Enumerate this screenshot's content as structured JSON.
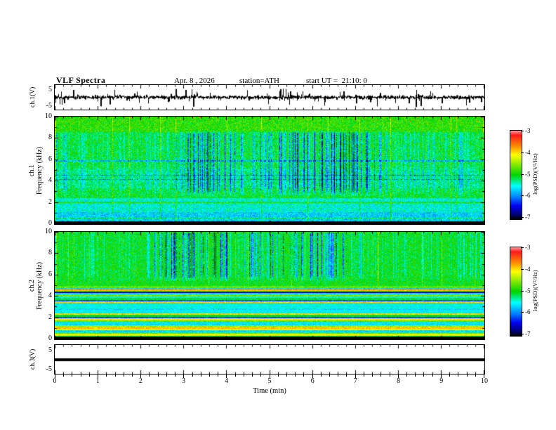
{
  "header": {
    "title": "VLF Spectra",
    "date": "Apr. 8 , 2026",
    "station": "station=ATH",
    "start_ut": "start UT =  21:10: 0"
  },
  "x_axis": {
    "label": "Time (min)",
    "ticks": [
      0,
      1,
      2,
      3,
      4,
      5,
      6,
      7,
      8,
      9,
      10
    ],
    "range": [
      0,
      10
    ],
    "minor_tick_step": 0.2
  },
  "colorbar": {
    "label": "log(PSD)(V²/Hz)",
    "ticks": [
      -3,
      -4,
      -5,
      -6,
      -7
    ],
    "range_top_to_bottom": [
      -3,
      -7
    ],
    "stops": [
      {
        "v": -3.0,
        "c": "#ff9e9e"
      },
      {
        "v": -3.2,
        "c": "#ff1a1a"
      },
      {
        "v": -3.7,
        "c": "#ff8c00"
      },
      {
        "v": -4.1,
        "c": "#ffff00"
      },
      {
        "v": -5.0,
        "c": "#00d400"
      },
      {
        "v": -5.5,
        "c": "#00ffff"
      },
      {
        "v": -6.0,
        "c": "#0080ff"
      },
      {
        "v": -6.4,
        "c": "#0000ee"
      },
      {
        "v": -6.75,
        "c": "#000080"
      },
      {
        "v": -7.0,
        "c": "#000000"
      }
    ]
  },
  "chart_data": [
    {
      "type": "line",
      "name": "ch1-waveform",
      "ylabel": "ch.1(V)",
      "ylim": [
        -5,
        5
      ],
      "yticks": [
        5,
        -5
      ],
      "xlim": [
        0,
        10
      ],
      "description": "broadband noise around 0 V with impulsive spikes up to ±4 V",
      "noise_rms": 0.45,
      "spike_rate": 0.06,
      "spike_max": 4
    },
    {
      "type": "heatmap",
      "name": "ch1-spectrogram",
      "ylabel": [
        "ch.1",
        "Frequency (kHz)"
      ],
      "ylim": [
        0,
        10
      ],
      "yticks": [
        0,
        2,
        4,
        6,
        8,
        10
      ],
      "xlim": [
        0,
        10
      ],
      "zlim": [
        -7,
        -3
      ],
      "seed": 20260408,
      "base_bands": [
        {
          "f": [
            0,
            0.22
          ],
          "level": -7.0
        },
        {
          "f": [
            0.22,
            1.1
          ],
          "level": -5.7
        },
        {
          "f": [
            1.1,
            2.4
          ],
          "level": -5.45
        },
        {
          "f": [
            2.4,
            3.3
          ],
          "level": -5.05
        },
        {
          "f": [
            3.3,
            5.2
          ],
          "level": -5.2
        },
        {
          "f": [
            5.2,
            8.6
          ],
          "level": -5.05
        },
        {
          "f": [
            8.6,
            10
          ],
          "level": -4.85
        }
      ],
      "vertical_streaks": {
        "f_range": [
          2.5,
          8.8
        ],
        "density": 0.55,
        "max_depth": 2.3
      },
      "bright_columns": {
        "density": 0.02,
        "boost": 0.55
      },
      "dark_lines_khz": [
        4.15,
        4.55,
        5.9
      ],
      "bright_lines_khz": [
        2.02,
        1.0,
        0.55,
        0.33
      ],
      "speckle": 0.65,
      "red_speckle_above_khz": 9.55
    },
    {
      "type": "heatmap",
      "name": "ch2-spectrogram",
      "ylabel": [
        "ch.2",
        "Frequency (kHz)"
      ],
      "ylim": [
        0,
        10
      ],
      "yticks": [
        0,
        2,
        4,
        6,
        8,
        10
      ],
      "xlim": [
        0,
        10
      ],
      "zlim": [
        -7,
        -3
      ],
      "seed": 777,
      "upper_level": -5.0,
      "vertical_streaks": {
        "f_range": [
          5.35,
          10
        ],
        "density": 0.5,
        "max_depth": 2.2
      },
      "bright_columns": {
        "density": 0.018,
        "boost": 0.5
      },
      "banded_region": {
        "f_range": [
          0.22,
          4.95
        ],
        "band_width_khz": 0.16,
        "palette": [
          -5.15,
          -4.55,
          -4.1,
          -3.85,
          -5.6,
          -6.1
        ],
        "cyan_zone_khz": [
          2.45,
          3.35
        ]
      },
      "strong_lines": [
        {
          "f": 4.62,
          "level": -3.7
        },
        {
          "f": 4.38,
          "level": -6.5
        }
      ],
      "dc_black_band_khz": 0.22,
      "speckle": 0.55
    },
    {
      "type": "line",
      "name": "ch3-waveform",
      "ylabel": "ch.3(V)",
      "ylim": [
        -5,
        5
      ],
      "yticks": [
        5,
        -5
      ],
      "xlim": [
        0,
        10
      ],
      "description": "flat saturated trace at 0 V (thick black line)",
      "value": 0
    }
  ]
}
